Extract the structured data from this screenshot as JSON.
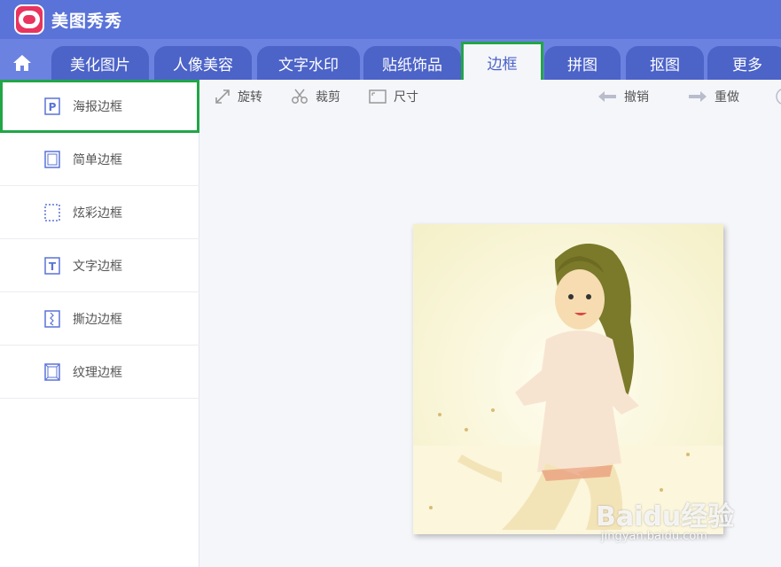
{
  "app": {
    "name": "美图秀秀"
  },
  "tabs": [
    {
      "label": "美化图片"
    },
    {
      "label": "人像美容"
    },
    {
      "label": "文字水印"
    },
    {
      "label": "贴纸饰品"
    },
    {
      "label": "边框",
      "active": true
    },
    {
      "label": "拼图"
    },
    {
      "label": "抠图"
    },
    {
      "label": "更多"
    }
  ],
  "sidebar": {
    "items": [
      {
        "label": "海报边框",
        "icon": "poster-frame-icon",
        "active": true
      },
      {
        "label": "简单边框",
        "icon": "simple-frame-icon"
      },
      {
        "label": "炫彩边框",
        "icon": "colorful-frame-icon"
      },
      {
        "label": "文字边框",
        "icon": "text-frame-icon"
      },
      {
        "label": "撕边边框",
        "icon": "torn-edge-frame-icon"
      },
      {
        "label": "纹理边框",
        "icon": "texture-frame-icon"
      }
    ]
  },
  "toolbar": {
    "rotate": "旋转",
    "crop": "裁剪",
    "size": "尺寸",
    "undo": "撤销",
    "redo": "重做"
  },
  "watermark": {
    "main": "Baidu经验",
    "sub": "jingyan.baidu.com"
  },
  "colors": {
    "titlebar": "#5a73d8",
    "tabbar": "#6b82e0",
    "tab": "#4c63c8",
    "highlight": "#21a647"
  }
}
